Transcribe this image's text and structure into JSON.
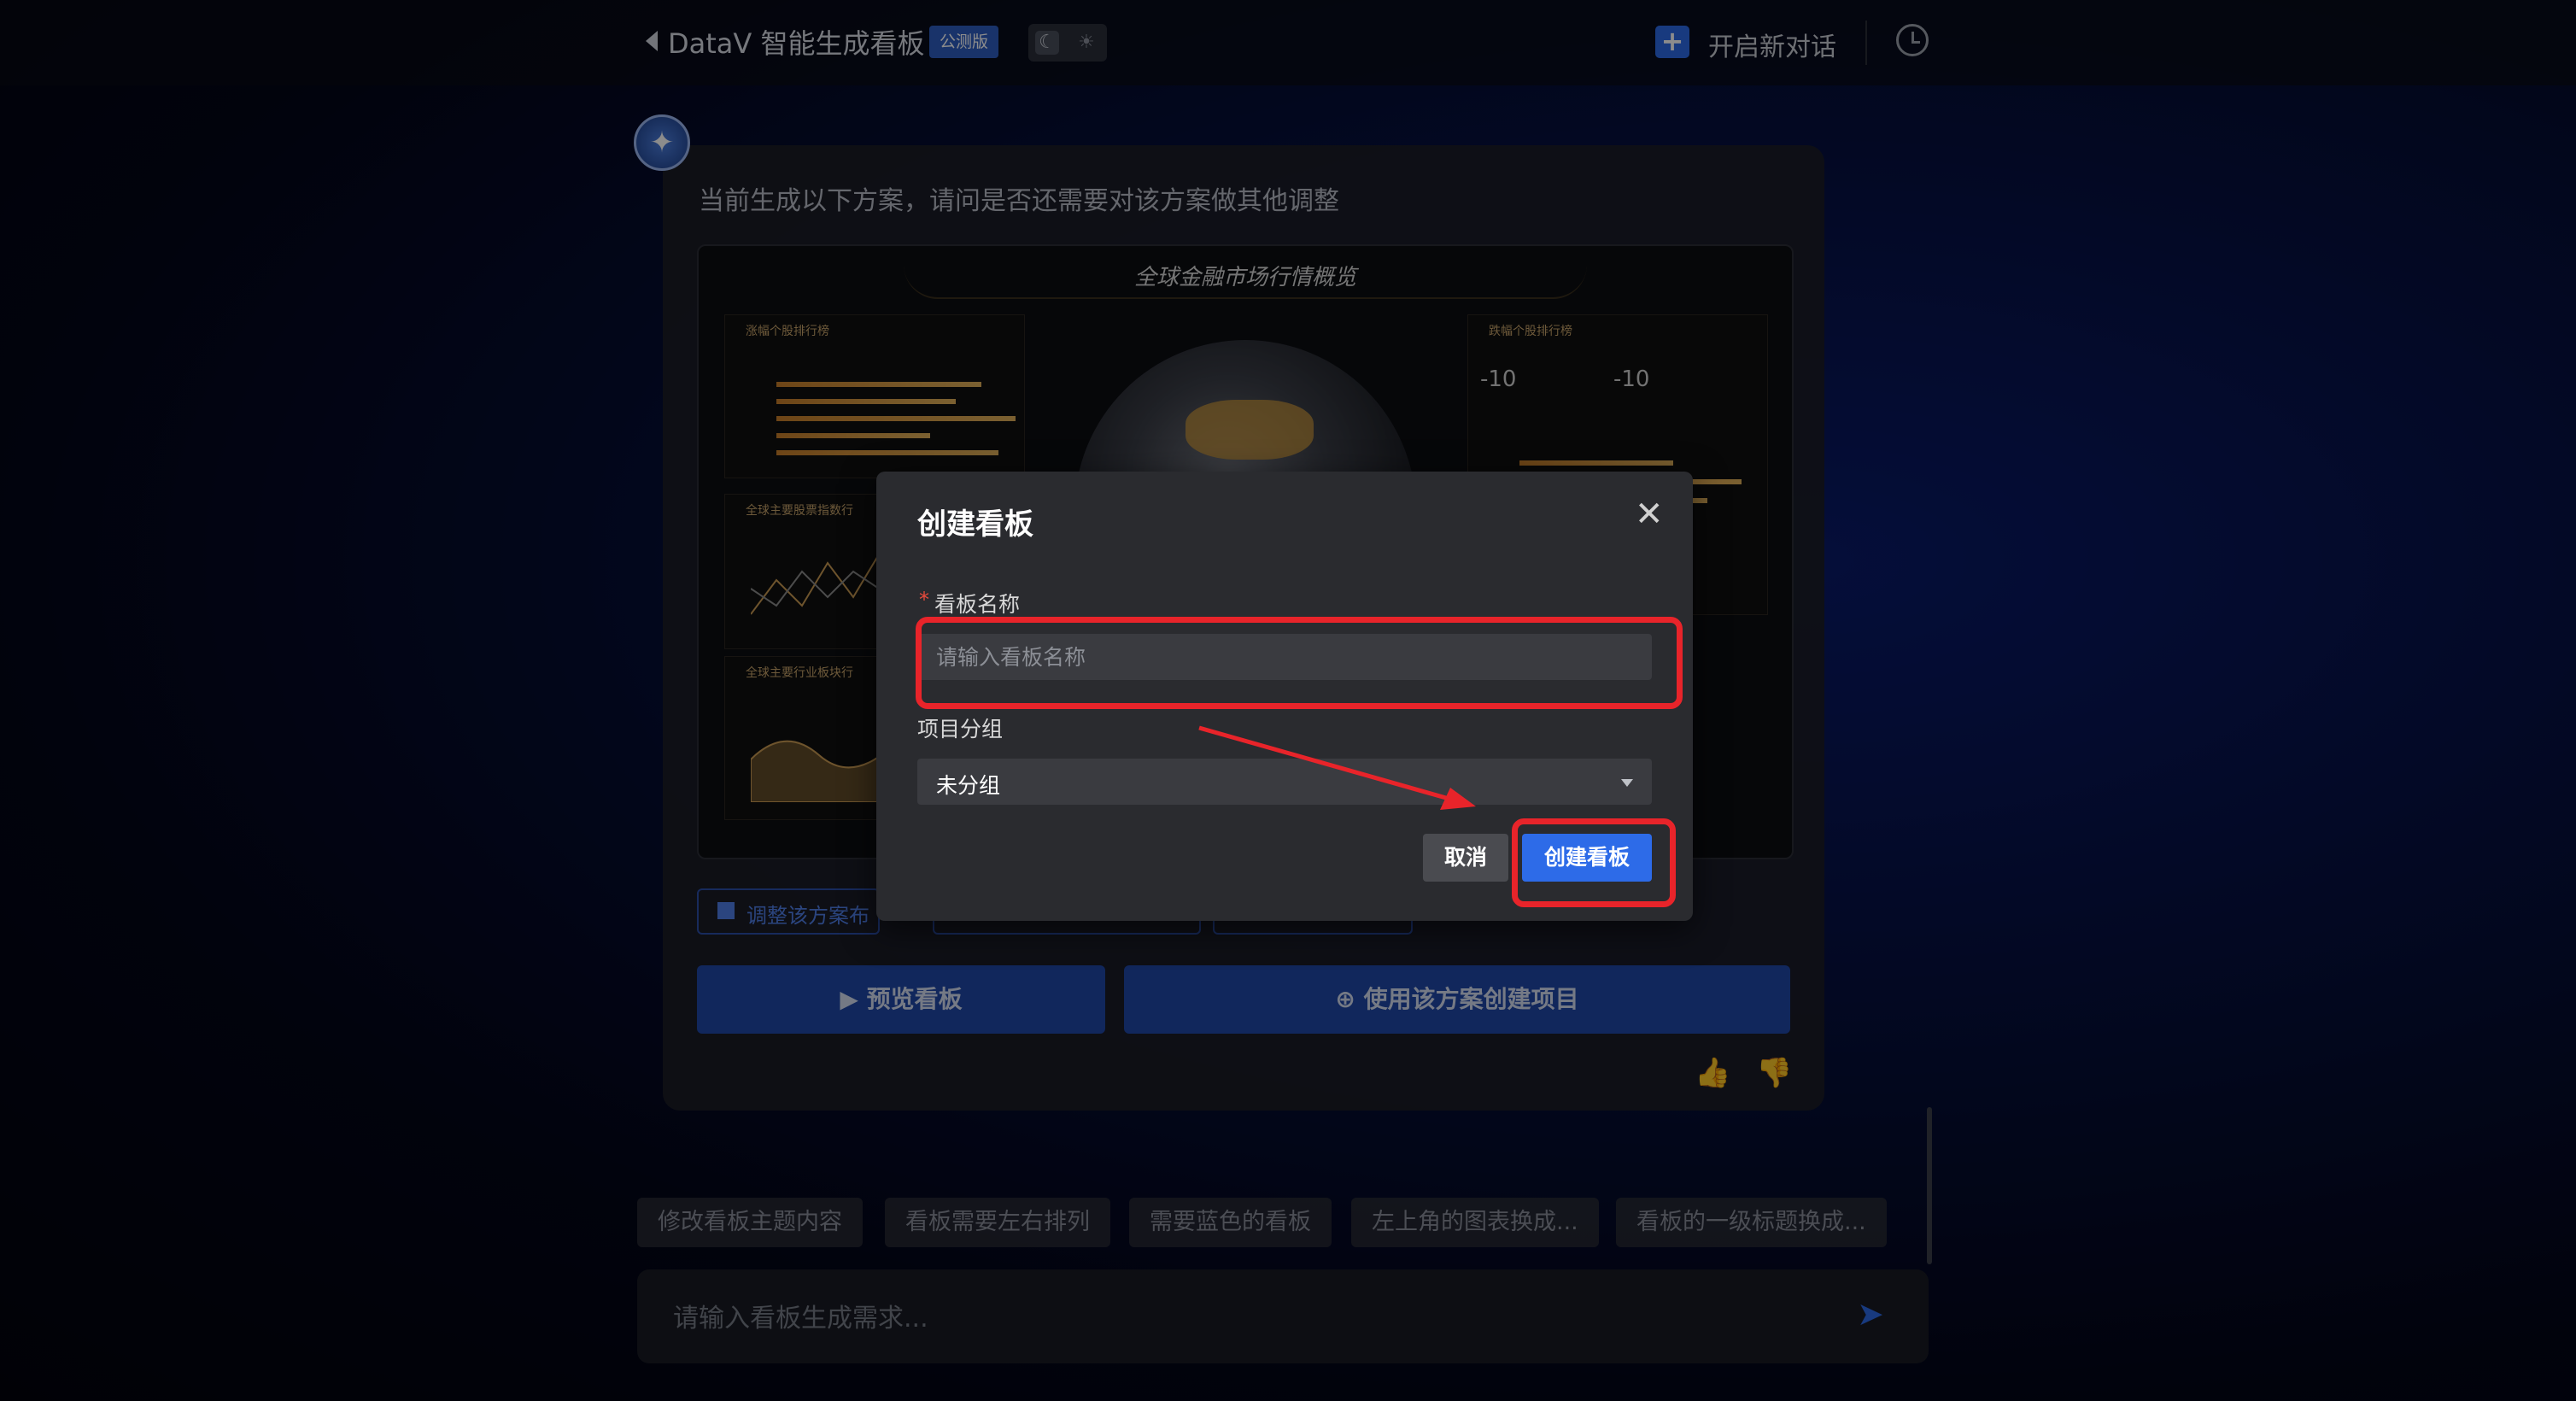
{
  "header": {
    "title": "DataV 智能生成看板",
    "badge": "公测版",
    "new_chat": "开启新对话",
    "icons": [
      "back-arrow-icon",
      "moon-icon",
      "sun-icon",
      "new-chat-icon",
      "history-icon"
    ]
  },
  "chat": {
    "message": "当前生成以下方案，请问是否还需要对该方案做其他调整",
    "preview": {
      "title": "全球金融市场行情概览",
      "panel_1_title": "涨幅个股排行榜",
      "panel_2_title": "全球主要股票指数行",
      "panel_3_title": "全球主要行业板块行",
      "panel_right_title": "跌幅个股排行榜",
      "kpi_1": "-10",
      "kpi_2": "-10"
    },
    "chip_1": "调整该方案布",
    "preview_button": "预览看板",
    "create_project_button": "使用该方案创建项目"
  },
  "suggestions": [
    "修改看板主题内容",
    "看板需要左右排列",
    "需要蓝色的看板",
    "左上角的图表换成...",
    "看板的一级标题换成..."
  ],
  "input": {
    "placeholder": "请输入看板生成需求..."
  },
  "modal": {
    "title": "创建看板",
    "name_label": "看板名称",
    "required_mark": "*",
    "name_placeholder": "请输入看板名称",
    "group_label": "项目分组",
    "group_value": "未分组",
    "cancel": "取消",
    "create": "创建看板"
  },
  "annotation_color": "#e8242a",
  "accent_color": "#2d6be8"
}
